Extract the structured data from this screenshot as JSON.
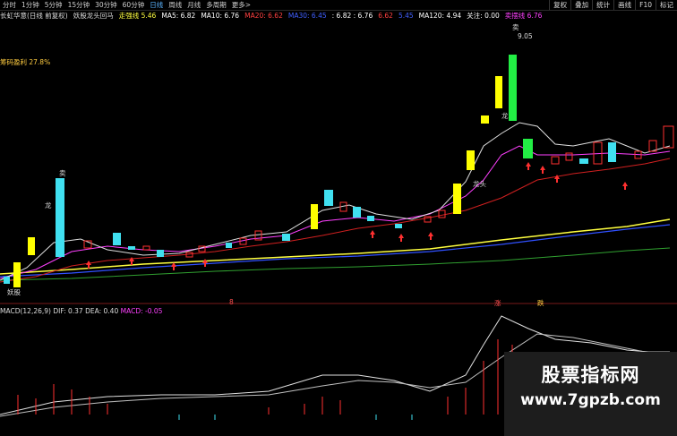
{
  "toolbar": {
    "periods": [
      "分时",
      "1分钟",
      "5分钟",
      "15分钟",
      "30分钟",
      "60分钟",
      "日线",
      "周线",
      "月线",
      "多周期",
      "更多>"
    ],
    "active_period": "日线",
    "right_buttons": [
      "复权",
      "叠加",
      "统计",
      "画线",
      "F10",
      "标记"
    ]
  },
  "infobar": {
    "stock": "长虹华意(日线 前复权)",
    "indicator_name": "妖股龙头回马",
    "line1_label": "走强线 5.46",
    "ma5": "MA5: 6.82",
    "ma10": "MA10: 6.76",
    "ma20": "MA20: 6.62",
    "ma30": "MA30: 6.45",
    "ma60": ": 6.82 : 6.76",
    "ma90": "6.62",
    "ma_extra": "5.45",
    "ma120": "MA120: 4.94",
    "guanzhu": "关注: 0.00",
    "line_mai": "卖摆线 6.76"
  },
  "annotations": {
    "chip_profit": "筹码盈利 27.8%",
    "high_price": "9.05",
    "sell_mark": "卖",
    "sell_mark2": "卖",
    "buy_mark_left": "妖股",
    "long_mark": "龙",
    "long_mark2": "龙",
    "long_mark3": "龙头",
    "bottom_tag_1": "8",
    "bottom_tag_2": "涨",
    "bottom_tag_3": "跌"
  },
  "macd": {
    "label": "MACD(12,26,9)",
    "dif": "DIF: 0.37",
    "dea": "DEA: 0.40",
    "macd": "MACD: -0.05"
  },
  "watermark": {
    "line1": "股票指标网",
    "line2": "www.7gpzb.com"
  },
  "colors": {
    "up": "#ff3030",
    "down": "#40e0f0",
    "yellow": "#ffff00",
    "green_bar": "#22ee44",
    "ma_white": "#e0e0e0",
    "ma_yellow": "#ffff40",
    "ma_blue": "#3050ff",
    "ma_green": "#30a030",
    "ma_red": "#d02020"
  }
}
